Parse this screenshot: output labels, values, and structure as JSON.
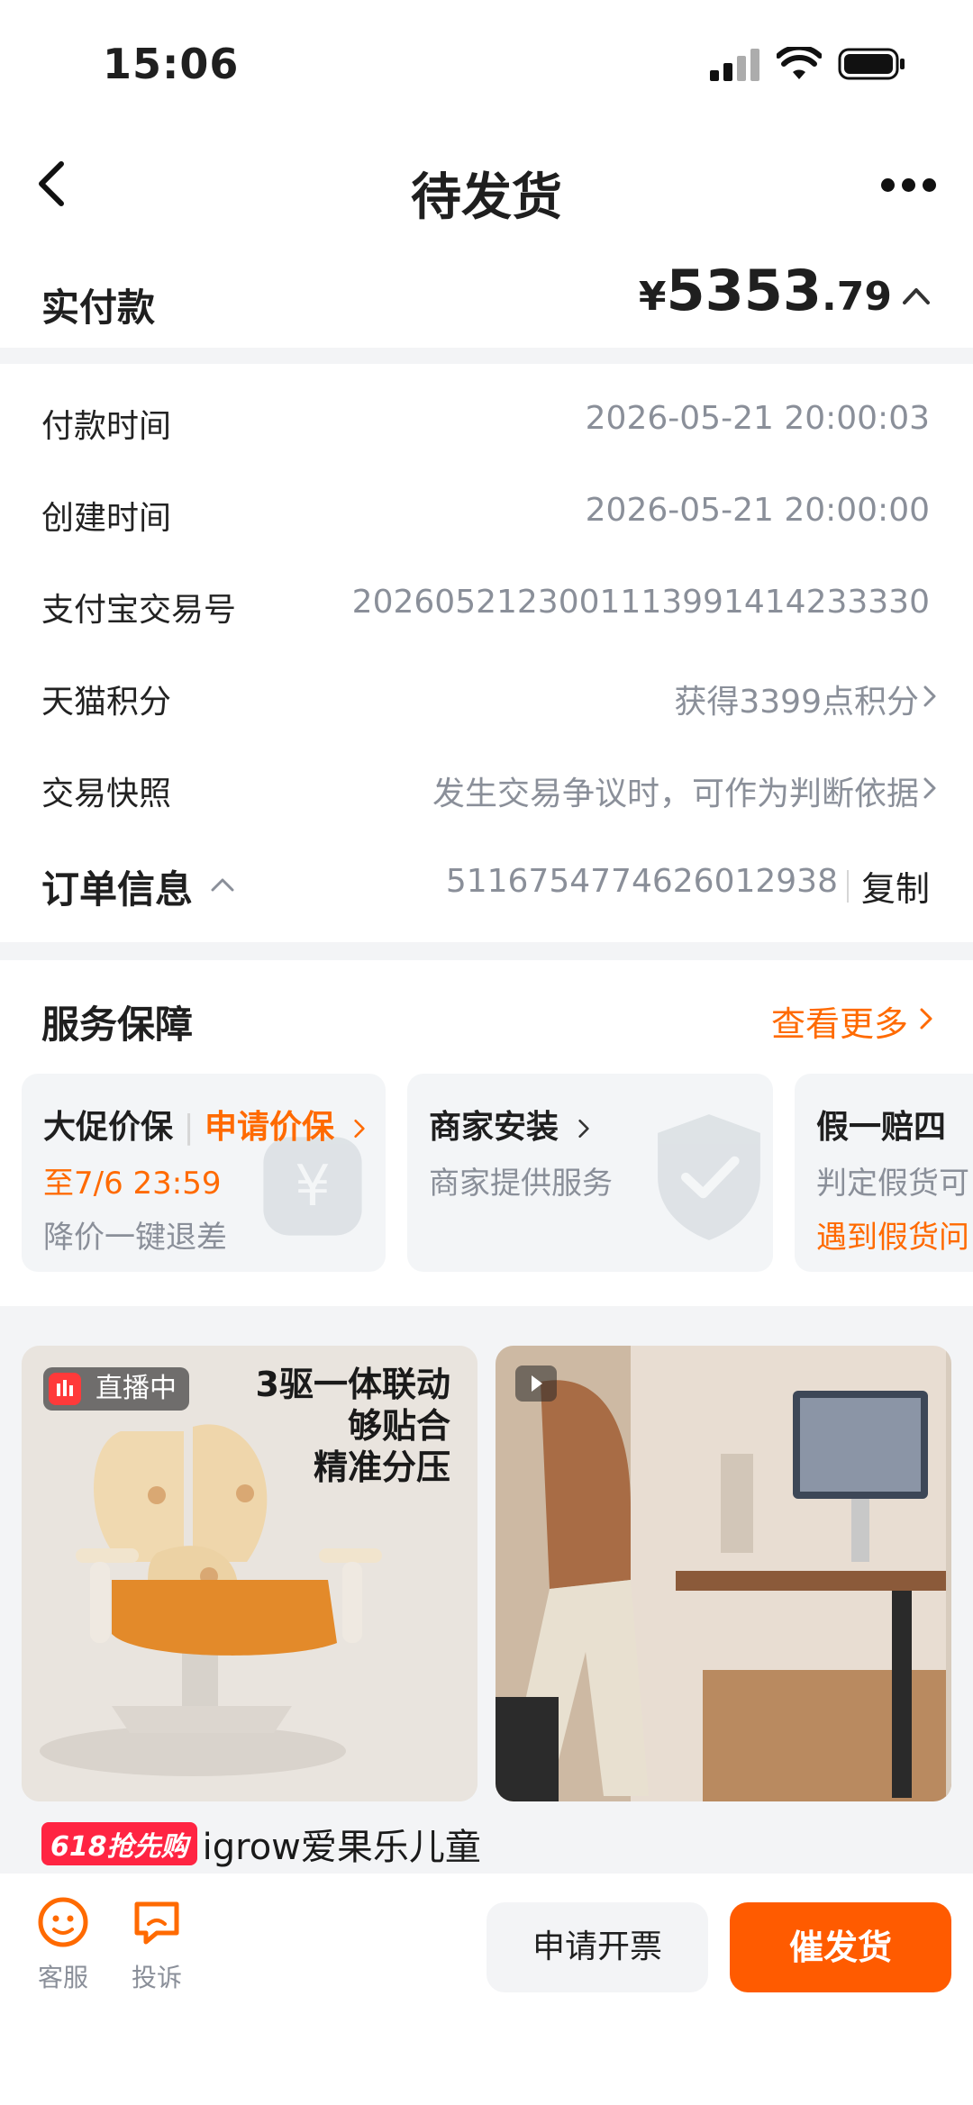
{
  "status_bar": {
    "time": "15:06"
  },
  "nav": {
    "title": "待发货"
  },
  "paid": {
    "label": "实付款",
    "currency": "¥",
    "amount_int": "5353",
    "amount_dec": ".79"
  },
  "rows": [
    {
      "label": "付款时间",
      "value": "2026-05-21 20:00:03"
    },
    {
      "label": "创建时间",
      "value": "2026-05-21 20:00:00"
    },
    {
      "label": "支付宝交易号",
      "value": "2026052123001113991414233330"
    },
    {
      "label": "天猫积分",
      "value": "获得3399点积分"
    },
    {
      "label": "交易快照",
      "value": "发生交易争议时，可作为判断依据"
    }
  ],
  "order": {
    "label": "订单信息",
    "number": "5116754774626012938",
    "copy": "复制"
  },
  "service": {
    "title": "服务保障",
    "more": "查看更多",
    "cards": [
      {
        "title": "大促价保",
        "action": "申请价保",
        "line2": "至7/6 23:59",
        "line3": "降价一键退差"
      },
      {
        "title": "商家安装",
        "line2": "商家提供服务"
      },
      {
        "title": "假一赔四",
        "line2": "判定假货可",
        "line3": "遇到假货问"
      }
    ]
  },
  "products": {
    "live_label": "直播中",
    "promo_lines": [
      "3驱一体联动",
      "够贴合",
      "精准分压"
    ],
    "badge": "618抢先购",
    "title": "igrow爱果乐儿童"
  },
  "bottom": {
    "service_label": "客服",
    "complain_label": "投诉",
    "invoice_button": "申请开票",
    "ship_button": "催发货"
  },
  "colors": {
    "accent": "#ff6a00",
    "primary_button": "#ff5b00",
    "muted_text": "#8a8f99"
  }
}
